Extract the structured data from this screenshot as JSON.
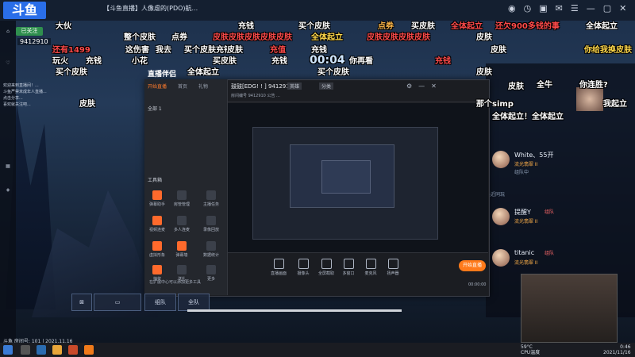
{
  "browser": {
    "tab_title": "【斗鱼直播】人像虐的(PDO)航...",
    "logo": "斗鱼"
  },
  "room": {
    "follow": "已关注",
    "id": "9412910",
    "left_notes": [
      "欢迎来到直播间！...",
      "斗鱼严禁未成年人直播...",
      "点击分享...",
      "喜欢就关注吧..."
    ]
  },
  "danmaku": [
    {
      "text": "大伙",
      "color": "#ffffff"
    },
    {
      "text": "充钱",
      "color": "#ffffff"
    },
    {
      "text": "买个皮肤",
      "color": "#ffffff"
    },
    {
      "text": "点券",
      "color": "#ffb84a"
    },
    {
      "text": "买皮肤",
      "color": "#ffffff"
    },
    {
      "text": "全体起立",
      "color": "#ff4a4a"
    },
    {
      "text": "还欠900多钱的事",
      "color": "#ff4a4a"
    },
    {
      "text": "全体起立",
      "color": "#ffffff"
    },
    {
      "text": "整个皮肤",
      "color": "#ffffff"
    },
    {
      "text": "点券",
      "color": "#ffffff"
    },
    {
      "text": "皮肤皮肤皮肤皮肤皮肤",
      "color": "#ff4a4a"
    },
    {
      "text": "全体起立",
      "color": "#ffd84a"
    },
    {
      "text": "皮肤皮肤皮肤皮肤",
      "color": "#ff4a4a"
    },
    {
      "text": "皮肤",
      "color": "#ffffff"
    },
    {
      "text": "这伤害",
      "color": "#ffffff"
    },
    {
      "text": "我去",
      "color": "#ffffff"
    },
    {
      "text": "买个皮肤充钱",
      "color": "#ffffff"
    },
    {
      "text": "皮肤",
      "color": "#ffffff"
    },
    {
      "text": "充值",
      "color": "#ff4a4a"
    },
    {
      "text": "充钱",
      "color": "#ffffff"
    },
    {
      "text": "皮肤",
      "color": "#ffffff"
    },
    {
      "text": "你给我换皮肤",
      "color": "#ffd84a"
    },
    {
      "text": "还有1499",
      "color": "#ff4a4a"
    },
    {
      "text": "玩火",
      "color": "#ffffff"
    },
    {
      "text": "充钱",
      "color": "#ffffff"
    },
    {
      "text": "小花",
      "color": "#ffffff"
    },
    {
      "text": "买皮肤",
      "color": "#ffffff"
    },
    {
      "text": "充钱",
      "color": "#ffffff"
    },
    {
      "text": "你再看",
      "color": "#ffffff"
    },
    {
      "text": "充钱",
      "color": "#ff4a4a"
    },
    {
      "text": "买个皮肤",
      "color": "#ffffff"
    },
    {
      "text": "全体起立",
      "color": "#ffffff"
    },
    {
      "text": "买个皮肤",
      "color": "#ffffff"
    },
    {
      "text": "皮肤",
      "color": "#ffffff"
    },
    {
      "text": "皮肤",
      "color": "#ffffff"
    },
    {
      "text": "全体起立！全体起立",
      "color": "#ffffff"
    },
    {
      "text": "皮肤",
      "color": "#ffffff"
    },
    {
      "text": "全牛",
      "color": "#ffffff"
    },
    {
      "text": "你连胜?",
      "color": "#ffffff"
    },
    {
      "text": "我起立",
      "color": "#ffffff"
    },
    {
      "text": "那个simp",
      "color": "#ffffff"
    }
  ],
  "hud": {
    "countdown": "00:04",
    "team": "组队",
    "all": "全队"
  },
  "right_users": [
    {
      "name": "White、55开",
      "level": "流光翡翠 II",
      "sub": "组队中"
    },
    {
      "name": "提醒Y",
      "level": "流光翡翠 II",
      "action": "组队"
    },
    {
      "name": "titanic",
      "level": "流光翡翠 II",
      "action": "组队"
    }
  ],
  "right_panel": {
    "section": "最近同玩"
  },
  "app": {
    "title": "直播伴侣",
    "nav": [
      "开始直播",
      "首页",
      "礼物"
    ],
    "scene": "全部 1",
    "tools_title": "工具箱",
    "tools": [
      "弹幕助手",
      "房管管理",
      "主播任务",
      "视频连麦",
      "多人连麦",
      "录像回放",
      "虚拟形象",
      "弹幕墙",
      "数据统计",
      "抽奖",
      "送礼",
      "更多"
    ],
    "tip": "在扩展中心可以添加更多工具",
    "room_title": "鼓鼓[EDG! ! ] 9412910",
    "room_tag": "英雄",
    "room_cat": "分类",
    "room_meta": "房间编号  9412910    公告  ...",
    "bottom": [
      "直播画面",
      "摄像头",
      "全屏截取",
      "多窗口",
      "麦克风",
      "扬声器"
    ],
    "start_label": "开始直播",
    "timer": "00:00:00"
  },
  "status": "斗鱼 房间号: 101 | 2021.11.16",
  "tray": {
    "temp": "59°C",
    "cpu": "CPU温度",
    "time": "0:46",
    "date": "2021/11/16"
  }
}
